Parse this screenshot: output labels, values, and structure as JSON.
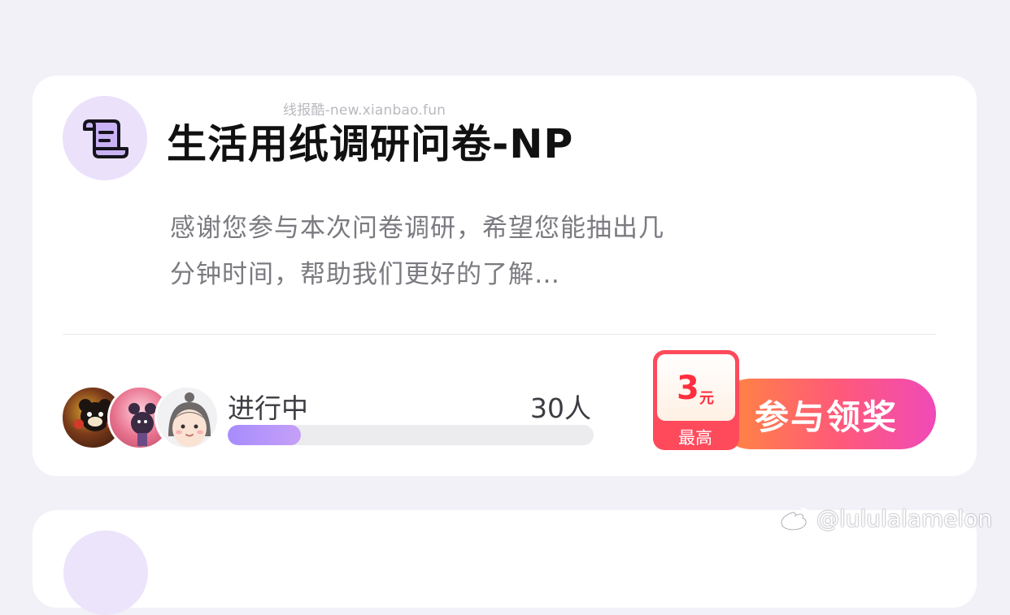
{
  "watermark": "线报酷-new.xianbao.fun",
  "survey": {
    "icon": "scroll-document-icon",
    "title": "生活用纸调研问卷-NP",
    "description": "感谢您参与本次问卷调研，希望您能抽出几分钟时间，帮助我们更好的了解…",
    "participants": {
      "avatars": [
        "participant-avatar-1",
        "participant-avatar-2",
        "participant-avatar-3"
      ],
      "status": "进行中",
      "count_label": "30人",
      "progress": 0.2
    },
    "reward": {
      "amount": "3",
      "unit": "元",
      "note": "最高"
    },
    "join_label": "参与领奖"
  },
  "weibo_watermark": {
    "icon": "weibo-icon",
    "handle": "@lululalamelon"
  },
  "colors": {
    "page_bg": "#f2f1f8",
    "card_bg": "#ffffff",
    "icon_circle": "#ebe1fb",
    "progress_fill": "#a78cff",
    "button_gradient_start": "#ff8a3c",
    "button_gradient_end": "#f04ab8",
    "reward_red": "#ff4a5c"
  }
}
